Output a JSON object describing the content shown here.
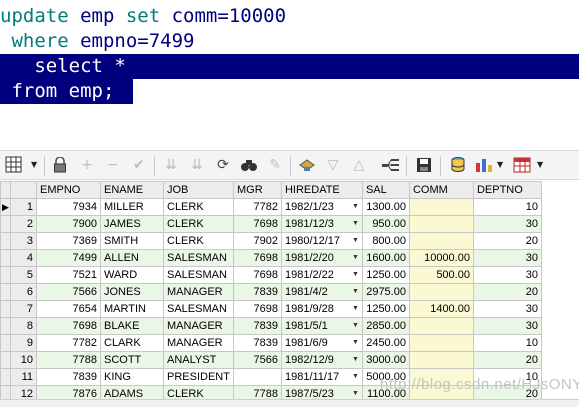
{
  "editor": {
    "line1": {
      "update": "update",
      "emp": " emp ",
      "set": "set",
      "assign": " comm=",
      "value": "10000"
    },
    "line2": {
      "where": " where",
      "assign": " empno=",
      "value": "7499"
    },
    "line3": "   select * ",
    "line4": " from emp; "
  },
  "toolbar": {
    "icons": [
      "grid-view-icon",
      "lock-icon",
      "add-row-icon",
      "delete-row-icon",
      "post-icon",
      "filter-down-icon",
      "filter-up-icon",
      "refresh-icon",
      "find-icon",
      "clear-icon",
      "export-icon",
      "sort-desc-icon",
      "sort-asc-icon",
      "query-icon",
      "save-icon",
      "database-icon",
      "chart-icon",
      "table-icon"
    ]
  },
  "grid": {
    "columns": [
      "EMPNO",
      "ENAME",
      "JOB",
      "MGR",
      "HIREDATE",
      "SAL",
      "COMM",
      "DEPTNO"
    ],
    "rows": [
      {
        "n": "1",
        "empno": "7934",
        "ename": "MILLER",
        "job": "CLERK",
        "mgr": "7782",
        "hiredate": "1982/1/23",
        "sal": "1300.00",
        "comm": "",
        "deptno": "10"
      },
      {
        "n": "2",
        "empno": "7900",
        "ename": "JAMES",
        "job": "CLERK",
        "mgr": "7698",
        "hiredate": "1981/12/3",
        "sal": "950.00",
        "comm": "",
        "deptno": "30"
      },
      {
        "n": "3",
        "empno": "7369",
        "ename": "SMITH",
        "job": "CLERK",
        "mgr": "7902",
        "hiredate": "1980/12/17",
        "sal": "800.00",
        "comm": "",
        "deptno": "20"
      },
      {
        "n": "4",
        "empno": "7499",
        "ename": "ALLEN",
        "job": "SALESMAN",
        "mgr": "7698",
        "hiredate": "1981/2/20",
        "sal": "1600.00",
        "comm": "10000.00",
        "deptno": "30"
      },
      {
        "n": "5",
        "empno": "7521",
        "ename": "WARD",
        "job": "SALESMAN",
        "mgr": "7698",
        "hiredate": "1981/2/22",
        "sal": "1250.00",
        "comm": "500.00",
        "deptno": "30"
      },
      {
        "n": "6",
        "empno": "7566",
        "ename": "JONES",
        "job": "MANAGER",
        "mgr": "7839",
        "hiredate": "1981/4/2",
        "sal": "2975.00",
        "comm": "",
        "deptno": "20"
      },
      {
        "n": "7",
        "empno": "7654",
        "ename": "MARTIN",
        "job": "SALESMAN",
        "mgr": "7698",
        "hiredate": "1981/9/28",
        "sal": "1250.00",
        "comm": "1400.00",
        "deptno": "30"
      },
      {
        "n": "8",
        "empno": "7698",
        "ename": "BLAKE",
        "job": "MANAGER",
        "mgr": "7839",
        "hiredate": "1981/5/1",
        "sal": "2850.00",
        "comm": "",
        "deptno": "30"
      },
      {
        "n": "9",
        "empno": "7782",
        "ename": "CLARK",
        "job": "MANAGER",
        "mgr": "7839",
        "hiredate": "1981/6/9",
        "sal": "2450.00",
        "comm": "",
        "deptno": "10"
      },
      {
        "n": "10",
        "empno": "7788",
        "ename": "SCOTT",
        "job": "ANALYST",
        "mgr": "7566",
        "hiredate": "1982/12/9",
        "sal": "3000.00",
        "comm": "",
        "deptno": "20"
      },
      {
        "n": "11",
        "empno": "7839",
        "ename": "KING",
        "job": "PRESIDENT",
        "mgr": "",
        "hiredate": "1981/11/17",
        "sal": "5000.00",
        "comm": "",
        "deptno": "10"
      },
      {
        "n": "12",
        "empno": "7876",
        "ename": "ADAMS",
        "job": "CLERK",
        "mgr": "7788",
        "hiredate": "1987/5/23",
        "sal": "1100.00",
        "comm": "",
        "deptno": "20"
      }
    ],
    "current_row_indicator": "▶"
  },
  "watermark": "http://blog.csdn.net/HJsONY"
}
